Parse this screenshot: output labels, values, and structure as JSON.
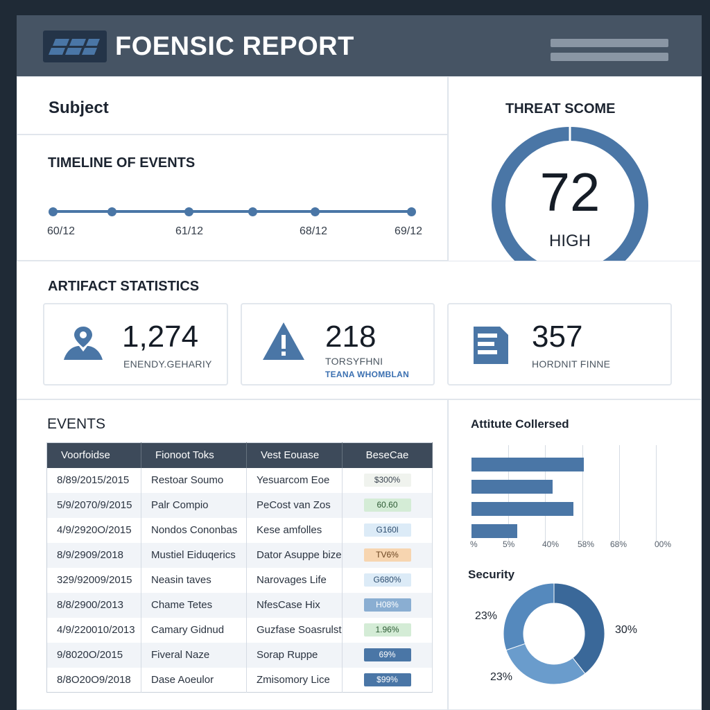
{
  "header": {
    "title": "FOENSIC REPORT",
    "logo_icon": "report-logo-icon",
    "menu_icon": "menu-icon"
  },
  "subject": {
    "label": "Subject"
  },
  "timeline": {
    "label": "TIMELINE OF EVENTS",
    "ticks": [
      "60/12",
      "61/12",
      "68/12",
      "69/12"
    ]
  },
  "threat": {
    "label": "THREAT SCOME",
    "score": "72",
    "level": "HIGH",
    "color": "#4a76a6"
  },
  "artifacts": {
    "label": "ARTIFACT STATISTICS",
    "cards": [
      {
        "value": "1,274",
        "caption": "ENENDY.GEHARIY",
        "icon": "user-pin-icon"
      },
      {
        "value": "218",
        "caption": "TORSYFHNI",
        "sub": "TEANA WHOMBLAN",
        "icon": "warning-icon"
      },
      {
        "value": "357",
        "caption": "HORDNIT FINNE",
        "icon": "document-icon"
      }
    ]
  },
  "events": {
    "label": "EVENTS",
    "columns": [
      "Voorfoidse",
      "Fionoot Toks",
      "Vest Eouase",
      "BeseCae"
    ],
    "rows": [
      [
        "8/89/2015/2015",
        "Restoar Soumo",
        "Yesuarcom Eoe",
        "$300%"
      ],
      [
        "5/9/2070/9/2015",
        "Palr Compio",
        "PeCost van Zos",
        "60.60"
      ],
      [
        "4/9/2920O/2015",
        "Nondos Cononbas",
        "Kese amfolles",
        "G160l"
      ],
      [
        "8/9/2909/2018",
        "Mustiel Eiduqerics",
        "Dator Asuppe bize",
        "TV6%"
      ],
      [
        "329/92009/2015",
        "Neasin taves",
        "Narovages Life",
        "G680%"
      ],
      [
        "8/8/2900/2013",
        "Chame Tetes",
        "NfesCase Hix",
        "H08%"
      ],
      [
        "4/9/220010/2013",
        "Camary Gidnud",
        "Guzfase Soasrulst",
        "1.96%"
      ],
      [
        "9/8020O/2015",
        "Fiveral Naze",
        "Sorap Ruppe",
        "69%"
      ],
      [
        "8/8O20O9/2018",
        "Dase Aoeulor",
        "Zmisomory Lice",
        "$99%"
      ]
    ]
  },
  "attitute": {
    "label": "Attitute Collersed",
    "ticks": [
      "%",
      "5%",
      "40%",
      "58%",
      "68%",
      "00%"
    ]
  },
  "chart_data": [
    {
      "type": "bar",
      "title": "Attitute Collersed",
      "orientation": "horizontal",
      "categories": [
        "",
        "",
        "",
        ""
      ],
      "values": [
        66,
        48,
        60,
        27
      ],
      "xlim": [
        0,
        100
      ],
      "color": "#4a76a6"
    },
    {
      "type": "pie",
      "title": "Security",
      "donut": true,
      "values": [
        30,
        23,
        23
      ],
      "labels": [
        "30%",
        "23%",
        "23%"
      ],
      "colors": [
        "#3a6899",
        "#6a9ccc",
        "#5589bd"
      ]
    }
  ],
  "security": {
    "label": "Security",
    "pct_right": "30%",
    "pct_left_top": "23%",
    "pct_left_bottom": "23%"
  }
}
